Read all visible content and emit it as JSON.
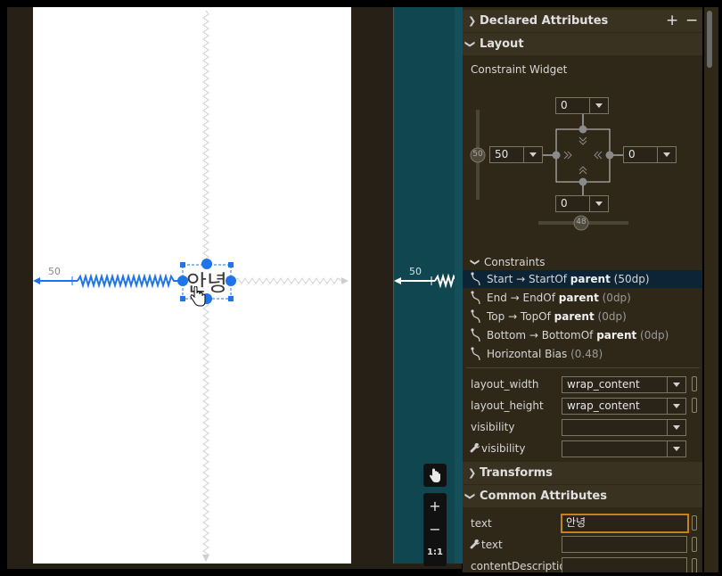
{
  "design": {
    "canvas_margin_label": "50",
    "widget_text": "안녕"
  },
  "blueprint": {
    "margin_label": "50"
  },
  "properties": {
    "declared_attributes_title": "Declared Attributes",
    "add_symbol": "+",
    "remove_symbol": "−",
    "layout_title": "Layout",
    "constraint_widget_label": "Constraint Widget",
    "constraint_widget": {
      "top": "0",
      "start": "50",
      "end": "0",
      "bottom": "0",
      "vertical_bias_marker": "50",
      "horizontal_bias_marker": "48"
    },
    "constraints_title": "Constraints",
    "constraints": [
      {
        "prefix": "Start → StartOf ",
        "target": "parent",
        "suffix": " (50dp)"
      },
      {
        "prefix": "End → EndOf ",
        "target": "parent",
        "suffix": " (0dp)"
      },
      {
        "prefix": "Top → TopOf ",
        "target": "parent",
        "suffix": " (0dp)"
      },
      {
        "prefix": "Bottom → BottomOf ",
        "target": "parent",
        "suffix": " (0dp)"
      },
      {
        "prefix": "Horizontal Bias ",
        "target": "",
        "suffix": " (0.48)"
      }
    ],
    "layout_width_label": "layout_width",
    "layout_width_value": "wrap_content",
    "layout_height_label": "layout_height",
    "layout_height_value": "wrap_content",
    "visibility_label": "visibility",
    "visibility_value": "",
    "tools_visibility_label": "visibility",
    "tools_visibility_value": "",
    "transforms_title": "Transforms",
    "common_attributes_title": "Common Attributes",
    "text_label": "text",
    "text_value": "안녕",
    "tools_text_label": "text",
    "tools_text_value": "",
    "content_description_label": "contentDescription"
  },
  "toolbar": {
    "zoom_in": "+",
    "zoom_out": "−",
    "zoom_reset": "1:1"
  },
  "colors": {
    "selection": "#1e74e8",
    "panel_bg": "#2f2717",
    "blueprint": "#10464f",
    "text_focus_border": "#c8801c"
  }
}
